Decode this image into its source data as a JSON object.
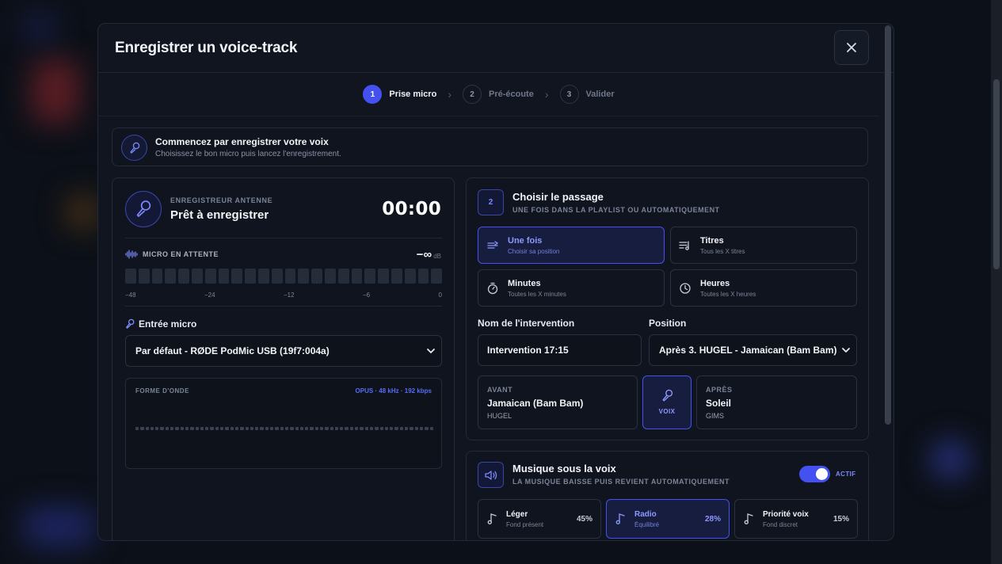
{
  "modal": {
    "title": "Enregistrer un voice-track",
    "close_label": "×"
  },
  "stepper": {
    "steps": [
      {
        "num": "1",
        "label": "Prise micro",
        "active": true
      },
      {
        "num": "2",
        "label": "Pré-écoute",
        "active": false
      },
      {
        "num": "3",
        "label": "Valider",
        "active": false
      }
    ]
  },
  "banner": {
    "title": "Commencez par enregistrer votre voix",
    "subtitle": "Choisissez le bon micro puis lancez l'enregistrement."
  },
  "recorder": {
    "kicker": "ENREGISTREUR ANTENNE",
    "status": "Prêt à enregistrer",
    "time": "00:00",
    "meter_label": "MICRO EN ATTENTE",
    "db_value": "−∞",
    "db_unit": "dB",
    "scale": [
      "−48",
      "−24",
      "−12",
      "−6",
      "0"
    ],
    "mic_label": "Entrée micro",
    "mic_value": "Par défaut - RØDE PodMic USB (19f7:004a)",
    "waveform_label": "FORME D'ONDE",
    "codec": "OPUS · 48 kHz · 192 kbps"
  },
  "placement": {
    "step_num": "2",
    "title": "Choisir le passage",
    "subtitle": "UNE FOIS DANS LA PLAYLIST OU AUTOMATIQUEMENT",
    "options": [
      {
        "title": "Une fois",
        "sub": "Choisir sa position",
        "icon": "list-insert-icon"
      },
      {
        "title": "Titres",
        "sub": "Tous les X titres",
        "icon": "playlist-icon"
      },
      {
        "title": "Minutes",
        "sub": "Toutes les X minutes",
        "icon": "timer-icon"
      },
      {
        "title": "Heures",
        "sub": "Toutes les X heures",
        "icon": "clock-icon"
      }
    ],
    "name_label": "Nom de l'intervention",
    "name_value": "Intervention 17:15",
    "position_label": "Position",
    "position_value": "Après 3. HUGEL - Jamaican (Bam Bam)",
    "before": {
      "kicker": "AVANT",
      "title": "Jamaican (Bam Bam)",
      "artist": "HUGEL"
    },
    "voice_label": "VOIX",
    "after": {
      "kicker": "APRÈS",
      "title": "Soleil",
      "artist": "GIMS"
    }
  },
  "music": {
    "title": "Musique sous la voix",
    "subtitle": "LA MUSIQUE BAISSE PUIS REVIENT AUTOMATIQUEMENT",
    "toggle_label": "ACTIF",
    "toggle_on": true,
    "modes": [
      {
        "title": "Léger",
        "sub": "Fond présent",
        "percent": "45%"
      },
      {
        "title": "Radio",
        "sub": "Équilibré",
        "percent": "28%"
      },
      {
        "title": "Priorité voix",
        "sub": "Fond discret",
        "percent": "15%"
      }
    ]
  },
  "colors": {
    "accent": "#4451f0",
    "accent_text": "#8d99ff",
    "background": "#101520"
  }
}
